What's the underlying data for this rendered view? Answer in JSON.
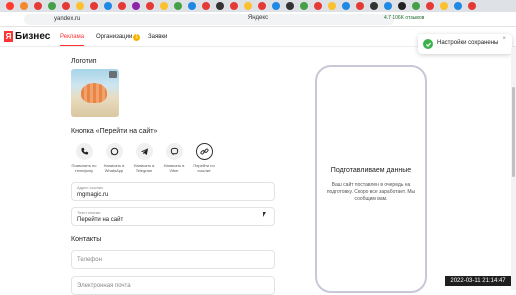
{
  "browser": {
    "url": "yandex.ru",
    "center_title": "Яндекс",
    "reviews": "4.7 106K отзывов"
  },
  "nav": {
    "brand": "Бизнес",
    "items": [
      {
        "label": "Реклама",
        "active": true
      },
      {
        "label": "Организации",
        "badge": "1"
      },
      {
        "label": "Заявки"
      }
    ]
  },
  "logo_section": {
    "title": "Логотип"
  },
  "buttons_section": {
    "title": "Кнопка «Перейти на сайт»",
    "options": [
      {
        "label": "Позвонить по телефону",
        "icon": "phone-icon"
      },
      {
        "label": "Написать в WhatsApp",
        "icon": "whatsapp-icon"
      },
      {
        "label": "Написать в Telegram",
        "icon": "telegram-icon"
      },
      {
        "label": "Написать в Viber",
        "icon": "viber-icon"
      },
      {
        "label": "Перейти по ссылке",
        "icon": "link-icon",
        "selected": true
      }
    ]
  },
  "fields": {
    "link_label": "Адрес ссылки",
    "link_value": "mgmagic.ru",
    "btn_text_label": "Текст кнопки",
    "btn_text_value": "Перейти на сайт"
  },
  "contacts": {
    "title": "Контакты",
    "phone_placeholder": "Телефон",
    "email_placeholder": "Электронная почта"
  },
  "preview": {
    "title": "Подготавливаем данные",
    "desc": "Ваш сайт поставлен в очередь на подготовку. Скоро все заработает. Мы сообщим вам."
  },
  "toast": {
    "text": "Настройки сохранены",
    "close": "×"
  },
  "timestamp": "2022-03-11  21:14:47",
  "colors": {
    "brand_red": "#ff3333",
    "success": "#3bb34a",
    "badge": "#f5b400"
  }
}
